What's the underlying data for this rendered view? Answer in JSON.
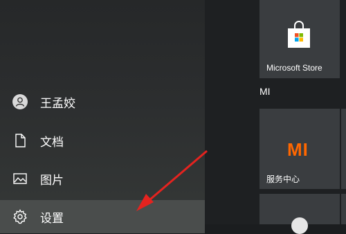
{
  "menu": {
    "items": [
      {
        "label": "王孟姣",
        "icon": "user-icon"
      },
      {
        "label": "文档",
        "icon": "document-icon"
      },
      {
        "label": "图片",
        "icon": "picture-icon"
      },
      {
        "label": "设置",
        "icon": "gear-icon"
      }
    ]
  },
  "tiles": {
    "store_label": "Microsoft Store",
    "group_header": "MI",
    "service_label": "服务中心",
    "mi_logo_text": "MI"
  },
  "colors": {
    "accent_arrow": "#e5231f",
    "mi_orange": "#ff6700"
  }
}
